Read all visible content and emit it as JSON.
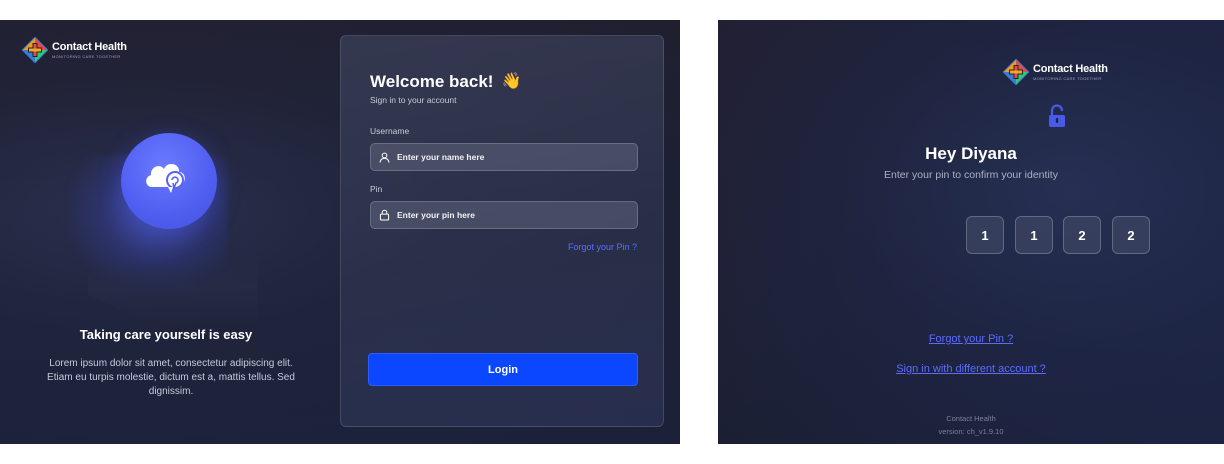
{
  "brand": {
    "name": "Contact Health",
    "tagline": "MONITORING CARE TOGETHER"
  },
  "left_panel": {
    "hero_title": "Taking care yourself is easy",
    "hero_description": "Lorem ipsum dolor sit amet, consectetur adipiscing elit. Etiam eu turpis molestie, dictum est a, mattis tellus. Sed dignissim."
  },
  "login_form": {
    "title": "Welcome back!",
    "wave_emoji": "👋",
    "subtitle": "Sign in to your account",
    "username_label": "Username",
    "username_placeholder": "Enter your name here",
    "pin_label": "Pin",
    "pin_placeholder": "Enter your pin here",
    "forgot_link": "Forgot your Pin ?",
    "login_button": "Login"
  },
  "pin_screen": {
    "greeting": "Hey Diyana",
    "instruction": "Enter your pin to confirm your identity",
    "pin_digits": [
      "1",
      "1",
      "2",
      "2"
    ],
    "forgot_link": "Forgot your Pin ?",
    "switch_account_link": "Sign in with different account ?",
    "footer_app": "Contact Health",
    "footer_version": "version: ch_v1.9.10"
  },
  "colors": {
    "accent": "#0a47ff",
    "link": "#5b6cff",
    "hero_circle": "#5563f5"
  }
}
